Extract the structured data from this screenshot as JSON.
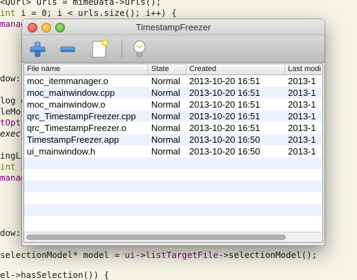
{
  "window": {
    "title": "TimestampFreezer"
  },
  "toolbar": {
    "add_icon": "plus-icon",
    "remove_icon": "minus-icon",
    "new_icon": "new-document-icon",
    "tip_icon": "lightbulb-icon"
  },
  "table": {
    "columns": [
      "File name",
      "State",
      "Created",
      "Last modi"
    ],
    "rows": [
      [
        "moc_itemmanager.o",
        "Normal",
        "2013-10-20 16:51",
        "2013-1"
      ],
      [
        "moc_mainwindow.cpp",
        "Normal",
        "2013-10-20 16:51",
        "2013-1"
      ],
      [
        "moc_mainwindow.o",
        "Normal",
        "2013-10-20 16:51",
        "2013-1"
      ],
      [
        "qrc_TimestampFreezer.cpp",
        "Normal",
        "2013-10-20 16:51",
        "2013-1"
      ],
      [
        "qrc_TimestampFreezer.o",
        "Normal",
        "2013-10-20 16:51",
        "2013-1"
      ],
      [
        "TimestampFreezer.app",
        "Normal",
        "2013-10-20 16:50",
        "2013-1"
      ],
      [
        "ui_mainwindow.h",
        "Normal",
        "2013-10-20 16:50",
        "2013-1"
      ]
    ]
  },
  "background_code": {
    "l1": "<QUrl> urls = mimeData->urls();",
    "l2a": "int",
    "l2b": " i = 0; i < urls.size(); i++) {",
    "l3": "manag",
    "l4": "dow:",
    "l5": "log d",
    "l6": "leMo",
    "l7": "tOpti",
    "l8": "exec(",
    "l9": "ingLi",
    "l10a": "int",
    "l10b": " i",
    "l11": "manag",
    "l12": "dow:",
    "l13a": "selectionModel* model = ",
    "l13b": "ui",
    "l13c": "->",
    "l13d": "listTargetFile",
    "l13e": "->selectionModel();",
    "l14": "el->hasSelection()) {"
  }
}
